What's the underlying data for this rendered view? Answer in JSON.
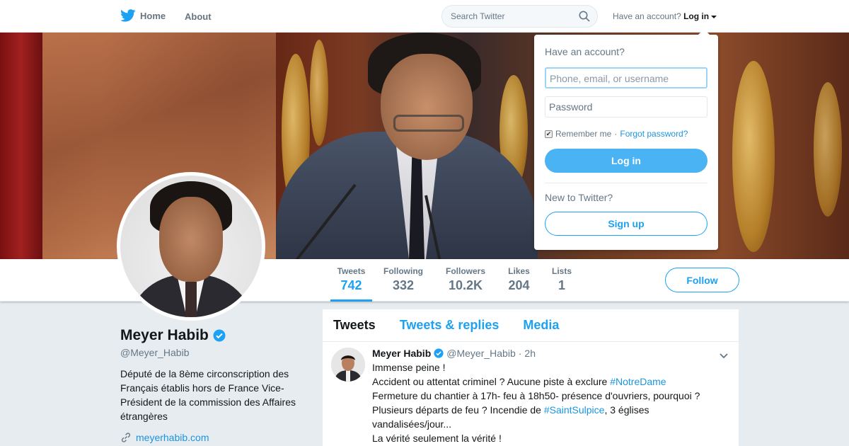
{
  "nav": {
    "home": "Home",
    "about": "About",
    "search_placeholder": "Search Twitter",
    "account_prompt": "Have an account?",
    "login_label": "Log in"
  },
  "login_popup": {
    "title": "Have an account?",
    "username_placeholder": "Phone, email, or username",
    "password_placeholder": "Password",
    "remember": "Remember me",
    "separator": "·",
    "forgot": "Forgot password?",
    "login_button": "Log in",
    "new_prompt": "New to Twitter?",
    "signup_button": "Sign up"
  },
  "stats": [
    {
      "label": "Tweets",
      "value": "742"
    },
    {
      "label": "Following",
      "value": "332"
    },
    {
      "label": "Followers",
      "value": "10.2K"
    },
    {
      "label": "Likes",
      "value": "204"
    },
    {
      "label": "Lists",
      "value": "1"
    }
  ],
  "follow_button": "Follow",
  "profile": {
    "name": "Meyer Habib",
    "handle": "@Meyer_Habib",
    "bio": "Député de la 8ème circonscription des Français établis hors de France Vice-Président de la commission des Affaires étrangères",
    "link": "meyerhabib.com"
  },
  "timeline_tabs": [
    "Tweets",
    "Tweets & replies",
    "Media"
  ],
  "tweet": {
    "name": "Meyer Habib",
    "handle": "@Meyer_Habib",
    "dot": "·",
    "time": "2h",
    "line1": "Immense peine !",
    "line2_a": "Accident ou attentat criminel ? Aucune piste à exclure ",
    "hashtag1": "#NotreDame",
    "line3": "Fermeture du chantier à 17h- feu à 18h50- présence d'ouvriers, pourquoi ?",
    "line4_a": "Plusieurs départs de feu ? Incendie de ",
    "hashtag2": "#SaintSulpice",
    "line4_b": ", 3 églises",
    "line5": "vandalisées/jour...",
    "line6": "La vérité seulement la vérité !"
  },
  "colors": {
    "accent": "#1da1f2",
    "link": "#1b95e0",
    "login_button": "#4ab3f4",
    "page_bg": "#e6ecf0"
  },
  "icons": [
    "twitter-bird-icon",
    "search-icon",
    "caret-down-icon",
    "verified-badge-icon",
    "link-icon",
    "chevron-down-icon",
    "checkbox-icon"
  ]
}
